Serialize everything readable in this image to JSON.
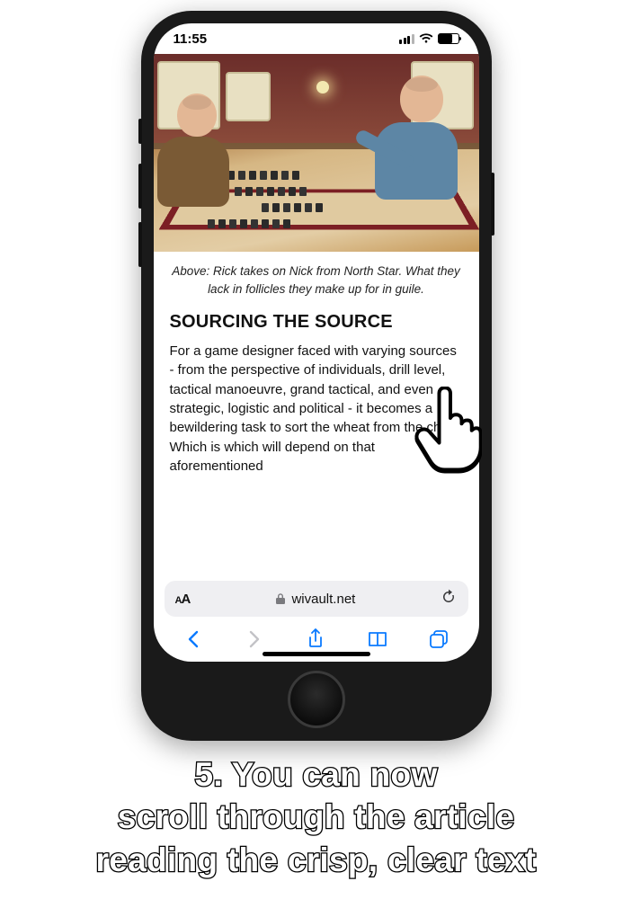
{
  "status": {
    "time": "11:55"
  },
  "photo_caption": "Above: Rick takes on Nick from North Star. What they lack in follicles they make up for in guile.",
  "article": {
    "heading": "SOURCING THE SOURCE",
    "body": "For a game designer faced with varying sources - from the perspective of individuals, drill level, tactical manoeuvre, grand tactical, and even strategic, logistic and political - it becomes a bewildering task to sort the wheat from the chaff. Which is which will depend on that aforementioned"
  },
  "browser": {
    "text_size_label": "AA",
    "domain": "wivault.net"
  },
  "step_caption": "5. You can now\nscroll through the article\nreading the crisp, clear text"
}
